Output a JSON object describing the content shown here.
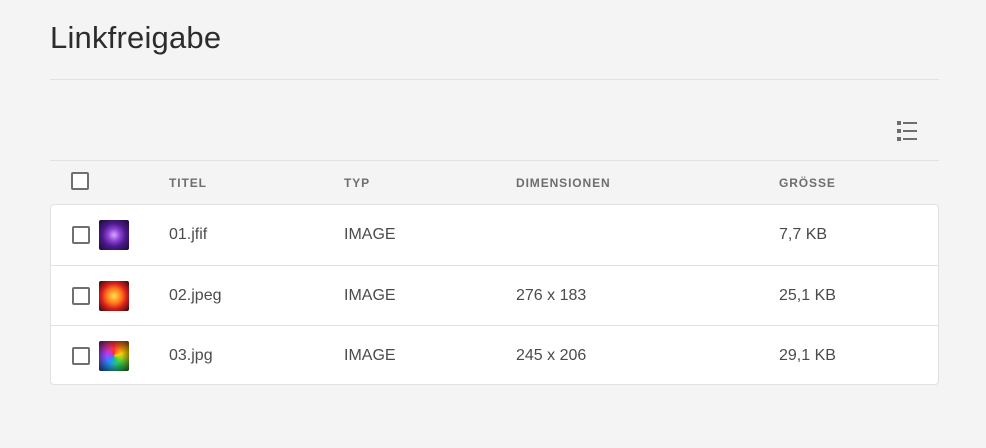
{
  "page": {
    "title": "Linkfreigabe"
  },
  "toolbar": {
    "view_icon": "list-view-icon"
  },
  "table": {
    "columns": [
      "TITEL",
      "TYP",
      "DIMENSIONEN",
      "GRÖSSE"
    ],
    "rows": [
      {
        "title": "01.jfif",
        "type": "IMAGE",
        "dimensions": "",
        "size": "7,7 KB",
        "thumb_colors": "#7b2fc0"
      },
      {
        "title": "02.jpeg",
        "type": "IMAGE",
        "dimensions": "276 x 183",
        "size": "25,1 KB",
        "thumb_colors": "#e8421a"
      },
      {
        "title": "03.jpg",
        "type": "IMAGE",
        "dimensions": "245 x 206",
        "size": "29,1 KB",
        "thumb_colors": "#2cd34f"
      }
    ]
  },
  "colors": {
    "background": "#f4f4f4",
    "card": "#ffffff",
    "divider": "#e1e1e1",
    "header_text": "#6e6e6e",
    "body_text": "#4b4b4b"
  }
}
